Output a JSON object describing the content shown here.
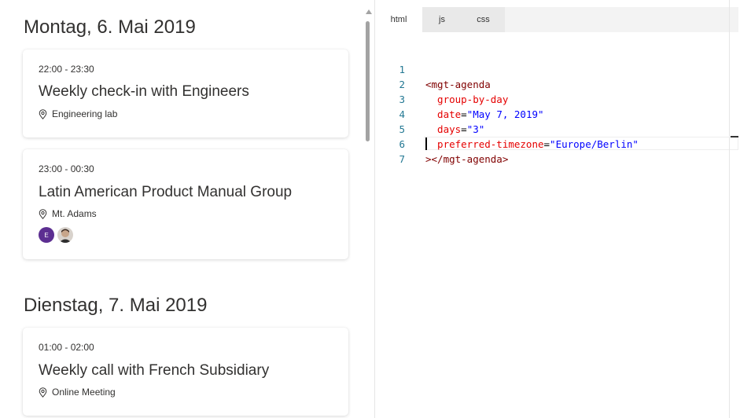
{
  "agenda": {
    "days": [
      {
        "header": "Montag, 6. Mai 2019",
        "events": [
          {
            "time": "22:00 - 23:30",
            "title": "Weekly check-in with Engineers",
            "location": "Engineering lab",
            "attendees": []
          },
          {
            "time": "23:00 - 00:30",
            "title": "Latin American Product Manual Group",
            "location": "Mt. Adams",
            "attendees": [
              {
                "type": "initial",
                "text": "E",
                "color": "#5c2e91"
              },
              {
                "type": "photo",
                "text": ""
              }
            ]
          }
        ]
      },
      {
        "header": "Dienstag, 7. Mai 2019",
        "events": [
          {
            "time": "01:00 - 02:00",
            "title": "Weekly call with French Subsidiary",
            "location": "Online Meeting",
            "attendees": []
          }
        ]
      }
    ],
    "icons": {
      "location": "map-pin-icon",
      "scroll_up": "triangle-up-icon"
    }
  },
  "editor": {
    "tabs": [
      {
        "label": "html",
        "active": true
      },
      {
        "label": "js",
        "active": false
      },
      {
        "label": "css",
        "active": false
      }
    ],
    "code_lines": [
      {
        "n": "1",
        "parts": [
          {
            "c": "t-tag",
            "t": "<mgt-agenda"
          }
        ]
      },
      {
        "n": "2",
        "parts": [
          {
            "c": "t-attr",
            "t": "  group-by-day"
          }
        ]
      },
      {
        "n": "3",
        "parts": [
          {
            "c": "t-attr",
            "t": "  date"
          },
          {
            "c": "t-pun",
            "t": "="
          },
          {
            "c": "t-str",
            "t": "\"May 7, 2019\""
          }
        ]
      },
      {
        "n": "4",
        "parts": [
          {
            "c": "t-attr",
            "t": "  days"
          },
          {
            "c": "t-pun",
            "t": "="
          },
          {
            "c": "t-str",
            "t": "\"3\""
          }
        ]
      },
      {
        "n": "5",
        "parts": [
          {
            "c": "t-attr",
            "t": "  preferred-timezone"
          },
          {
            "c": "t-pun",
            "t": "="
          },
          {
            "c": "t-str",
            "t": "\"Europe/Berlin\""
          }
        ]
      },
      {
        "n": "6",
        "parts": [
          {
            "c": "t-tag",
            "t": "></mgt-agenda>"
          }
        ]
      },
      {
        "n": "7",
        "parts": []
      }
    ],
    "colors": {
      "tag": "#800000",
      "attribute": "#e50000",
      "string": "#0000ff",
      "line_number": "#237893"
    }
  }
}
